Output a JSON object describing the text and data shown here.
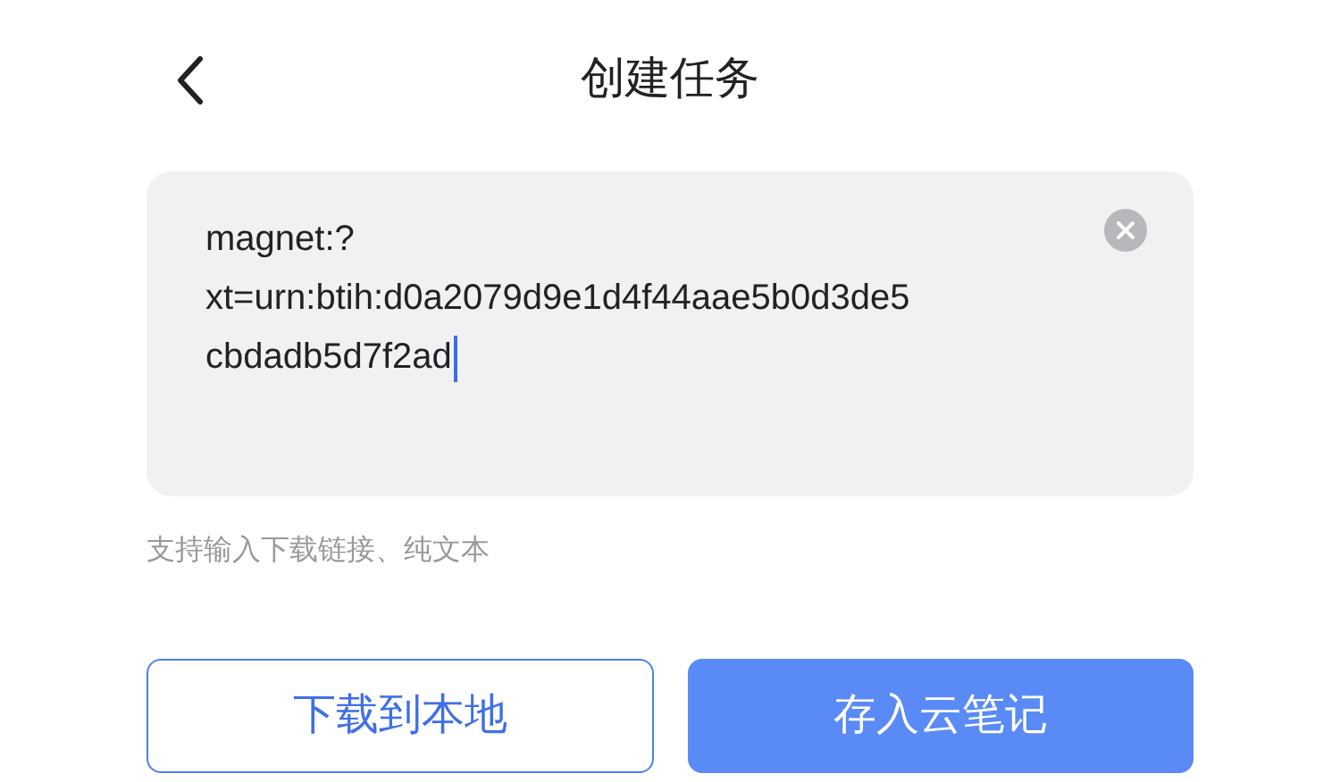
{
  "header": {
    "title": "创建任务"
  },
  "link_field": {
    "value_lines": [
      "magnet:?",
      "xt=urn:btih:d0a2079d9e1d4f44aae5b0d3de5",
      "cbdadb5d7f2ad"
    ],
    "focused": true
  },
  "hint": "支持输入下载链接、纯文本",
  "buttons": [
    {
      "label": "下载到本地",
      "kind": "outline"
    },
    {
      "label": "存入云笔记",
      "kind": "filled"
    }
  ]
}
